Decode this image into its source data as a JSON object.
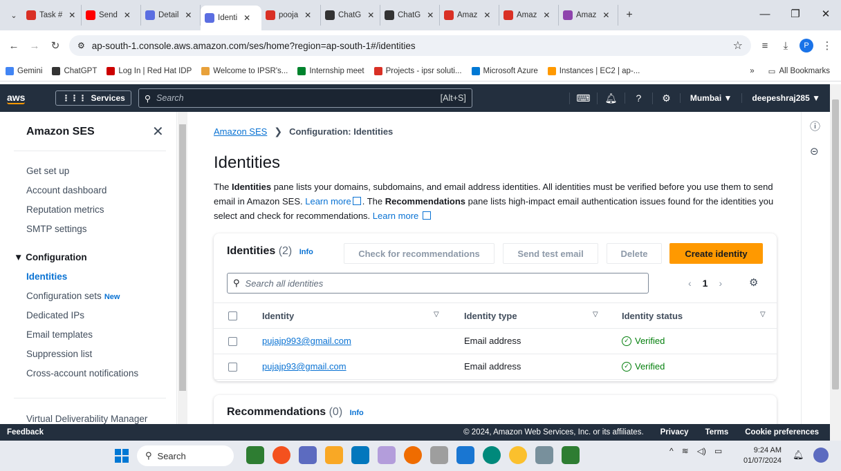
{
  "browser": {
    "tabs": [
      {
        "label": "Task #",
        "color": "#d93025",
        "active": false
      },
      {
        "label": "Send",
        "color": "#ff0000",
        "active": false
      },
      {
        "label": "Detail",
        "color": "#5b6ee1",
        "active": false
      },
      {
        "label": "Identi",
        "color": "#5b6ee1",
        "active": true
      },
      {
        "label": "pooja",
        "color": "#d93025",
        "active": false
      },
      {
        "label": "ChatG",
        "color": "#333333",
        "active": false
      },
      {
        "label": "ChatG",
        "color": "#333333",
        "active": false
      },
      {
        "label": "Amaz",
        "color": "#d93025",
        "active": false
      },
      {
        "label": "Amaz",
        "color": "#d93025",
        "active": false
      },
      {
        "label": "Amaz",
        "color": "#8e44ad",
        "active": false
      }
    ],
    "url": "ap-south-1.console.aws.amazon.com/ses/home?region=ap-south-1#/identities",
    "profile_initial": "P",
    "bookmarks": [
      {
        "label": "Gemini",
        "color": "#4285f4"
      },
      {
        "label": "ChatGPT",
        "color": "#333333"
      },
      {
        "label": "Log In | Red Hat IDP",
        "color": "#cc0000"
      },
      {
        "label": "Welcome to IPSR's...",
        "color": "#e8a13a"
      },
      {
        "label": "Internship meet",
        "color": "#00832d"
      },
      {
        "label": "Projects - ipsr soluti...",
        "color": "#d93025"
      },
      {
        "label": "Microsoft Azure",
        "color": "#0078d4"
      },
      {
        "label": "Instances | EC2 | ap-...",
        "color": "#ff9900"
      }
    ],
    "all_bookmarks": "All Bookmarks"
  },
  "aws": {
    "logo": "aws",
    "services": "Services",
    "search_placeholder": "Search",
    "search_hint": "[Alt+S]",
    "region": "Mumbai ▼",
    "user": "deepeshraj285 ▼"
  },
  "sidebar": {
    "title": "Amazon SES",
    "items_top": [
      "Get set up",
      "Account dashboard",
      "Reputation metrics",
      "SMTP settings"
    ],
    "section": "▼ Configuration",
    "config_items": [
      {
        "label": "Identities",
        "active": true
      },
      {
        "label": "Configuration sets",
        "badge": "New"
      },
      {
        "label": "Dedicated IPs"
      },
      {
        "label": "Email templates"
      },
      {
        "label": "Suppression list"
      },
      {
        "label": "Cross-account notifications"
      }
    ],
    "bottom_item": "Virtual Deliverability Manager"
  },
  "main": {
    "breadcrumb_root": "Amazon SES",
    "breadcrumb_current": "Configuration: Identities",
    "title": "Identities",
    "desc": {
      "p1": "The ",
      "b1": "Identities",
      "p2": " pane lists your domains, subdomains, and email address identities. All identities must be verified before you use them to send email in Amazon SES. ",
      "link1": "Learn more",
      "p3": ". The ",
      "b2": "Recommendations",
      "p4": " pane lists high-impact email authentication issues found for the identities you select and check for recommendations. ",
      "link2": "Learn more"
    }
  },
  "identities_panel": {
    "heading": "Identities",
    "count": "(2)",
    "info": "Info",
    "buttons": {
      "check": "Check for recommendations",
      "send": "Send test email",
      "delete": "Delete",
      "create": "Create identity"
    },
    "search_placeholder": "Search all identities",
    "page": "1",
    "columns": [
      "Identity",
      "Identity type",
      "Identity status"
    ],
    "rows": [
      {
        "identity": "pujajp993@gmail.com",
        "type": "Email address",
        "status": "Verified"
      },
      {
        "identity": "pujajp93@gmail.com",
        "type": "Email address",
        "status": "Verified"
      }
    ]
  },
  "recommendations_panel": {
    "heading": "Recommendations",
    "count": "(0)",
    "info": "Info"
  },
  "footer": {
    "feedback": "Feedback",
    "copyright": "© 2024, Amazon Web Services, Inc. or its affiliates.",
    "links": [
      "Privacy",
      "Terms",
      "Cookie preferences"
    ]
  },
  "taskbar": {
    "search": "Search",
    "time": "9:24 AM",
    "date": "01/07/2024"
  },
  "colors": {
    "aws_nav": "#232f3e",
    "link": "#0972d3",
    "primary_button": "#ff9900",
    "success": "#037f0c"
  }
}
